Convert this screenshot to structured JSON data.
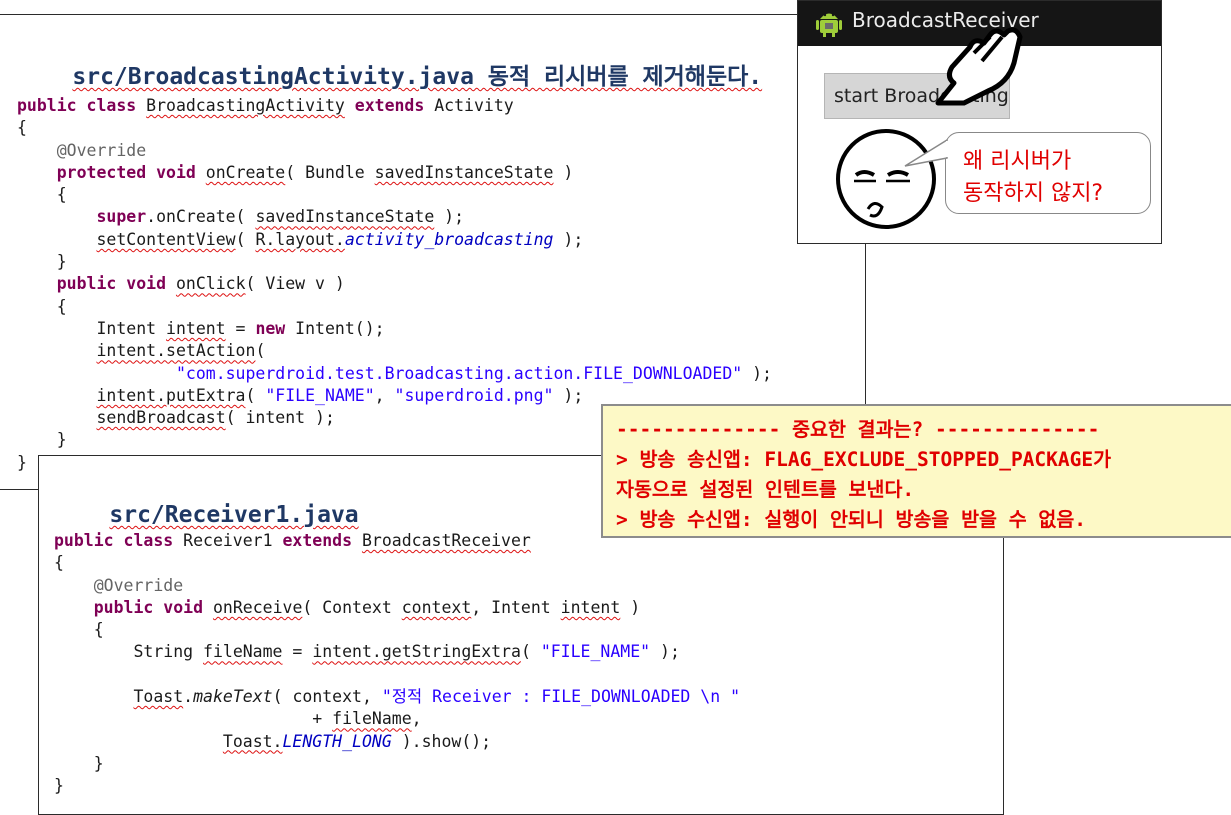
{
  "slide": {
    "activity_heading": "src/BroadcastingActivity.java 동적 리시버를 제거해둔다.",
    "receiver_heading": "src/Receiver1.java"
  },
  "activity_code": [
    [
      [
        "kw",
        "public class "
      ],
      [
        "sq",
        "BroadcastingActivity"
      ],
      [
        "kw",
        " extends "
      ],
      [
        "",
        "Activity"
      ]
    ],
    [
      [
        "",
        "{"
      ]
    ],
    [
      [
        "",
        "    "
      ],
      [
        "an",
        "@Override"
      ]
    ],
    [
      [
        "",
        "    "
      ],
      [
        "kw",
        "protected void "
      ],
      [
        "sq",
        "onCreate"
      ],
      [
        "",
        "( Bundle "
      ],
      [
        "sq",
        "savedInstanceState"
      ],
      [
        "",
        " )"
      ]
    ],
    [
      [
        "",
        "    {"
      ]
    ],
    [
      [
        "",
        "        "
      ],
      [
        "kw",
        "super"
      ],
      [
        "",
        ".onCreate( "
      ],
      [
        "sq",
        "savedInstanceState"
      ],
      [
        "",
        " );"
      ]
    ],
    [
      [
        "",
        "        "
      ],
      [
        "sq",
        "setContentView"
      ],
      [
        "",
        "( "
      ],
      [
        "sq",
        "R.layout."
      ],
      [
        "fld",
        "activity_broadcasting"
      ],
      [
        "",
        " );"
      ]
    ],
    [
      [
        "",
        "    }"
      ]
    ],
    [
      [
        "",
        "    "
      ],
      [
        "kw",
        "public void "
      ],
      [
        "sq",
        "onClick"
      ],
      [
        "",
        "( View v )"
      ]
    ],
    [
      [
        "",
        "    {"
      ]
    ],
    [
      [
        "",
        "        Intent "
      ],
      [
        "sq",
        "intent"
      ],
      [
        "",
        " = "
      ],
      [
        "kw",
        "new"
      ],
      [
        "",
        " Intent();"
      ]
    ],
    [
      [
        "",
        "        "
      ],
      [
        "sq",
        "intent.setAction"
      ],
      [
        "",
        "("
      ]
    ],
    [
      [
        "",
        "                "
      ],
      [
        "str",
        "\"com.superdroid.test.Broadcasting.action.FILE_DOWNLOADED\""
      ],
      [
        "",
        " );"
      ]
    ],
    [
      [
        "",
        "        "
      ],
      [
        "sq",
        "intent.putExtra"
      ],
      [
        "",
        "( "
      ],
      [
        "str",
        "\"FILE_NAME\""
      ],
      [
        ",",
        ""
      ],
      [
        "",
        " "
      ],
      [
        "str",
        "\"superdroid.png\""
      ],
      [
        "",
        " );"
      ]
    ],
    [
      [
        "",
        "        "
      ],
      [
        "sq",
        "sendBroadcast"
      ],
      [
        "",
        "( intent );"
      ]
    ],
    [
      [
        "",
        "    }"
      ]
    ],
    [
      [
        "",
        "}"
      ]
    ]
  ],
  "receiver_code": [
    [
      [
        "kw",
        "public class "
      ],
      [
        "",
        "Receiver1 "
      ],
      [
        "kw",
        "extends "
      ],
      [
        "sq",
        "BroadcastReceiver"
      ]
    ],
    [
      [
        "",
        "{"
      ]
    ],
    [
      [
        "",
        "    "
      ],
      [
        "an",
        "@Override"
      ]
    ],
    [
      [
        "",
        "    "
      ],
      [
        "kw",
        "public void "
      ],
      [
        "sq",
        "onReceive"
      ],
      [
        "",
        "( Context "
      ],
      [
        "sq",
        "context"
      ],
      [
        "",
        ", Intent "
      ],
      [
        "sq",
        "intent"
      ],
      [
        "",
        " )"
      ]
    ],
    [
      [
        "",
        "    {"
      ]
    ],
    [
      [
        "",
        "        String "
      ],
      [
        "sq",
        "fileName"
      ],
      [
        "",
        " = "
      ],
      [
        "sq",
        "intent.getStringExtra"
      ],
      [
        "",
        "( "
      ],
      [
        "str",
        "\"FILE_NAME\""
      ],
      [
        "",
        " );"
      ]
    ],
    [
      [
        "",
        ""
      ]
    ],
    [
      [
        "",
        "        "
      ],
      [
        "sq",
        "Toast"
      ],
      [
        ".",
        ""
      ],
      [
        "it",
        "makeText"
      ],
      [
        "",
        "( context, "
      ],
      [
        "str",
        "\"정적 Receiver : FILE_DOWNLOADED \\n \""
      ]
    ],
    [
      [
        "",
        "                          + "
      ],
      [
        "sq",
        "fileName"
      ],
      [
        "",
        ","
      ]
    ],
    [
      [
        "",
        "                 "
      ],
      [
        "sq",
        "Toast."
      ],
      [
        "fld",
        "LENGTH_LONG"
      ],
      [
        "",
        " ).show();"
      ]
    ],
    [
      [
        "",
        "    }"
      ]
    ],
    [
      [
        "",
        "}"
      ]
    ]
  ],
  "phone": {
    "app_title": "BroadcastReceiver",
    "start_button": "start Broadcasting",
    "bubble_line1": "왜 리시버가",
    "bubble_line2": "동작하지 않지?"
  },
  "notice": {
    "line1": "-------------- 중요한 결과는? --------------",
    "line2": "> 방송 송신앱: FLAG_EXCLUDE_STOPPED_PACKAGE가",
    "line3": "자동으로 설정된 인텐트를 보낸다.",
    "line4": "> 방송 수신앱: 실행이 안되니 방송을 받을 수 없음."
  },
  "colors": {
    "keyword": "#7f0055",
    "string": "#2a00ff",
    "annotation": "#646464",
    "heading": "#1f3864",
    "notice_text": "#e00000",
    "notice_bg": "#fdf9c6"
  },
  "icons": [
    "android-icon",
    "pointing-hand-icon",
    "cartoon-face-icon"
  ]
}
